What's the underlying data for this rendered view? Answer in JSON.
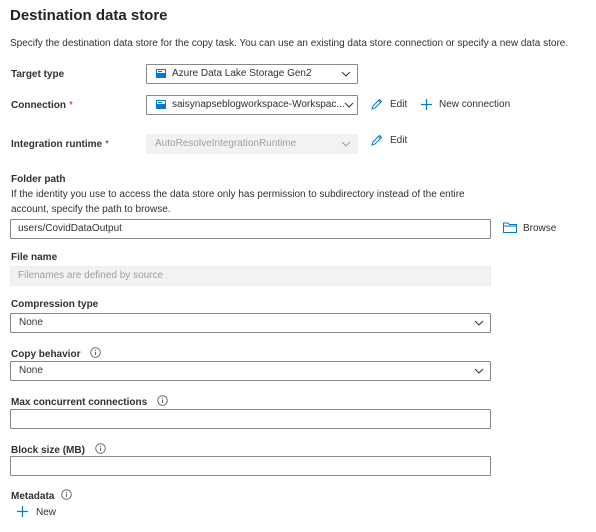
{
  "header": {
    "title": "Destination data store",
    "description": "Specify the destination data store for the copy task. You can use an existing data store connection or specify a new data store."
  },
  "target_type": {
    "label": "Target type",
    "value": "Azure Data Lake Storage Gen2",
    "icon": "storage-icon"
  },
  "connection": {
    "label": "Connection",
    "required_mark": "*",
    "value": "saisynapseblogworkspace-Workspac...",
    "icon": "storage-icon",
    "edit_label": "Edit",
    "new_label": "New connection"
  },
  "integration_runtime": {
    "label": "Integration runtime",
    "required_mark": "*",
    "value": "AutoResolveIntegrationRuntime",
    "edit_label": "Edit"
  },
  "folder_path": {
    "label": "Folder path",
    "help_line1": "If the identity you use to access the data store only has permission to subdirectory instead of the entire",
    "help_line2": "account, specify the path to browse.",
    "value": "users/CovidDataOutput",
    "browse_label": "Browse"
  },
  "file_name": {
    "label": "File name",
    "placeholder": "Filenames are defined by source"
  },
  "compression_type": {
    "label": "Compression type",
    "value": "None"
  },
  "copy_behavior": {
    "label": "Copy behavior",
    "value": "None"
  },
  "max_concurrent_connections": {
    "label": "Max concurrent connections",
    "value": ""
  },
  "block_size": {
    "label": "Block size (MB)",
    "value": ""
  },
  "metadata": {
    "label": "Metadata",
    "new_label": "New"
  },
  "colors": {
    "text": "#323130",
    "border": "#8a8886",
    "disabled_bg": "#f3f2f1",
    "required": "#a4262c",
    "icon_blue": "#0078d4"
  }
}
